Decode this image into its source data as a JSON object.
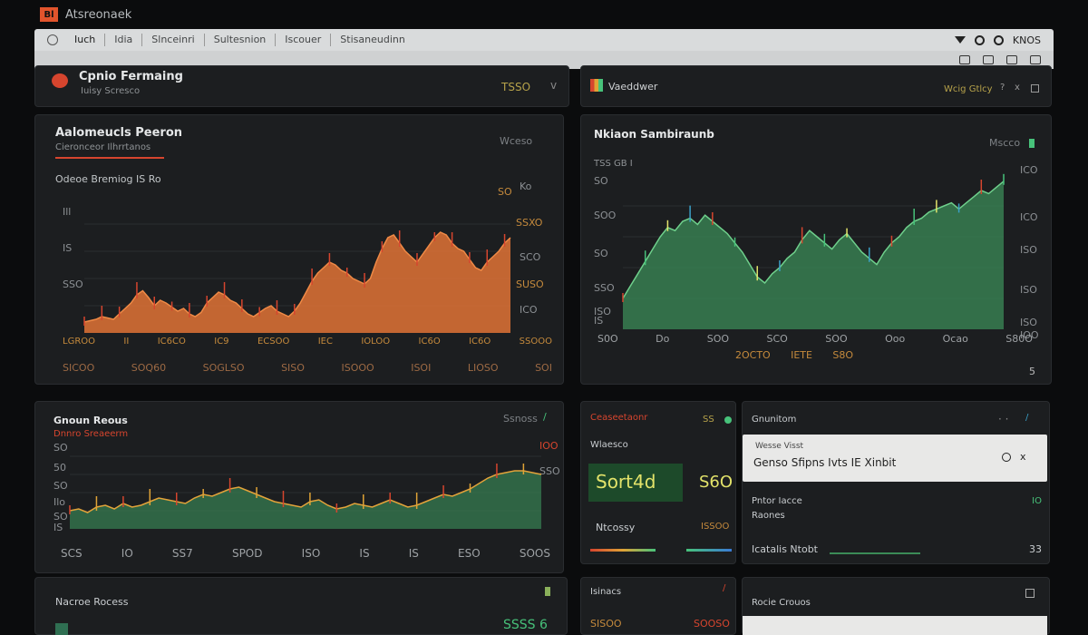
{
  "app": {
    "logo_text": "Bl",
    "title": "Atsreonaek"
  },
  "tabs": [
    "Iuch",
    "Idia",
    "Slnceinri",
    "Sultesnion",
    "Iscouer",
    "Stisaneudinn"
  ],
  "tabbar_right": {
    "label": "KNOS"
  },
  "header_left": {
    "title": "Cpnio Fermaing",
    "subtitle": "Iuisy Scresco",
    "value": "TSSO"
  },
  "header_right": {
    "title": "Vaeddwer",
    "right_text": "Wcig Gtlcy"
  },
  "panel_orange": {
    "title": "Aalomeucls Peeron",
    "subtitle": "Cieronceor Ilhrrtanos",
    "chart_title": "Odeoe Bremiog IS Ro",
    "top_right": "Wceso",
    "y_labels": [
      "Ill",
      "IS",
      "SSO"
    ],
    "right_labels": [
      "SO",
      "Ko",
      "SSXO",
      "SCO",
      "SUSO",
      "ICO"
    ],
    "x_labels": [
      "LGROO",
      "II",
      "IC6CO",
      "IC9",
      "ECSOO",
      "IEC",
      "IOLOO",
      "IC6O",
      "IC6O",
      "SSOOO"
    ],
    "footer_labels": [
      "SICOO",
      "SOQ60",
      "SOGLSO",
      "SISO",
      "ISOOO",
      "ISOI",
      "LIOSO",
      "SOI"
    ],
    "chart_data": {
      "type": "area",
      "series": [
        {
          "values": [
            8,
            9,
            10,
            12,
            11,
            10,
            14,
            18,
            22,
            28,
            31,
            26,
            20,
            24,
            22,
            19,
            16,
            18,
            14,
            12,
            15,
            22,
            26,
            30,
            28,
            24,
            22,
            18,
            14,
            12,
            15,
            18,
            20,
            16,
            14,
            12,
            16,
            22,
            30,
            38,
            44,
            48,
            52,
            50,
            46,
            44,
            40,
            38,
            36,
            40,
            52,
            62,
            70,
            72,
            66,
            60,
            56,
            52,
            58,
            64,
            70,
            74,
            72,
            66,
            62,
            60,
            54,
            48,
            46,
            52,
            56,
            60,
            66,
            70
          ]
        }
      ],
      "ylim": [
        0,
        100
      ]
    }
  },
  "panel_green": {
    "title": "Nkiaon Sambiraunb",
    "subtitle": "TSS GB I",
    "top_right": "Mscco",
    "y_labels": [
      "SO",
      "SOO",
      "SO",
      "SSO",
      "ISO",
      "IS"
    ],
    "right_labels": [
      "ICO",
      "ICO",
      "ISO",
      "ISO",
      "ISO",
      "IOO"
    ],
    "x_labels": [
      "S0O",
      "Do",
      "SOO",
      "SCO",
      "SOO",
      "Ooo",
      "Ocao",
      "S80O"
    ],
    "x_labels_2": [
      "2OCTO",
      "IETE",
      "S8O"
    ],
    "corner": "5",
    "chart_data": {
      "type": "area",
      "series": [
        {
          "values": [
            20,
            28,
            36,
            44,
            52,
            60,
            66,
            64,
            70,
            72,
            68,
            74,
            70,
            66,
            62,
            56,
            50,
            42,
            34,
            30,
            36,
            40,
            46,
            50,
            58,
            64,
            60,
            56,
            52,
            58,
            62,
            56,
            50,
            46,
            42,
            50,
            56,
            60,
            66,
            70,
            72,
            76,
            78,
            80,
            82,
            78,
            82,
            86,
            90,
            88,
            92,
            96
          ]
        }
      ],
      "ylim": [
        0,
        100
      ]
    }
  },
  "panel_bottom_left": {
    "title": "Gnoun Reous",
    "subtitle": "Dnnro Sreaeerm",
    "top_right": "Ssnoss",
    "right_labels": [
      "IOO",
      "SSO"
    ],
    "y_labels": [
      "SO",
      "50",
      "SO",
      "Ilo",
      "SO",
      "IS"
    ],
    "x_labels": [
      "SCS",
      "IO",
      "SS7",
      "SPOD",
      "ISO",
      "IS",
      "IS",
      "ESO",
      "SOOS"
    ],
    "chart_data": {
      "type": "area",
      "series": [
        {
          "values": [
            20,
            22,
            18,
            24,
            26,
            22,
            28,
            24,
            26,
            30,
            34,
            32,
            30,
            28,
            34,
            38,
            36,
            40,
            44,
            46,
            42,
            38,
            34,
            30,
            28,
            26,
            24,
            30,
            32,
            26,
            22,
            24,
            28,
            26,
            24,
            28,
            32,
            28,
            24,
            26,
            30,
            34,
            38,
            36,
            40,
            44,
            50,
            56,
            60,
            62,
            64,
            64,
            62,
            60
          ]
        }
      ],
      "ylim": [
        0,
        100
      ]
    }
  },
  "panel_mid_cards": {
    "title": "Ceaseetaonr",
    "subtitle": "Wlaesco",
    "counter": "SS",
    "big_value": "Sort4d",
    "big_value_right": "S6O",
    "row2_left": "Ntcossy",
    "row2_right": "ISSOO"
  },
  "panel_search": {
    "title": "Gnunitom",
    "search_caption": "Wesse Visst",
    "search_text": "Genso Sfipns Ivts IE Xinbit",
    "list": [
      {
        "label": "Pntor Iacce",
        "value": "IO"
      },
      {
        "label": "Raones",
        "value": ""
      },
      {
        "label": "Icatalis Ntobt",
        "value": "33"
      }
    ]
  },
  "panel_bottom_row": {
    "left_title": "Nacroe Rocess",
    "left_value": "SSSS 6",
    "mid_title": "Isinacs",
    "mid_value_a": "SISOO",
    "mid_value_b": "SOOSO",
    "right_title": "Rocie Crouos"
  },
  "colors": {
    "orange": "#e07336",
    "green": "#3b8b57",
    "accent_red": "#d6452e",
    "accent_green": "#47c27a"
  }
}
